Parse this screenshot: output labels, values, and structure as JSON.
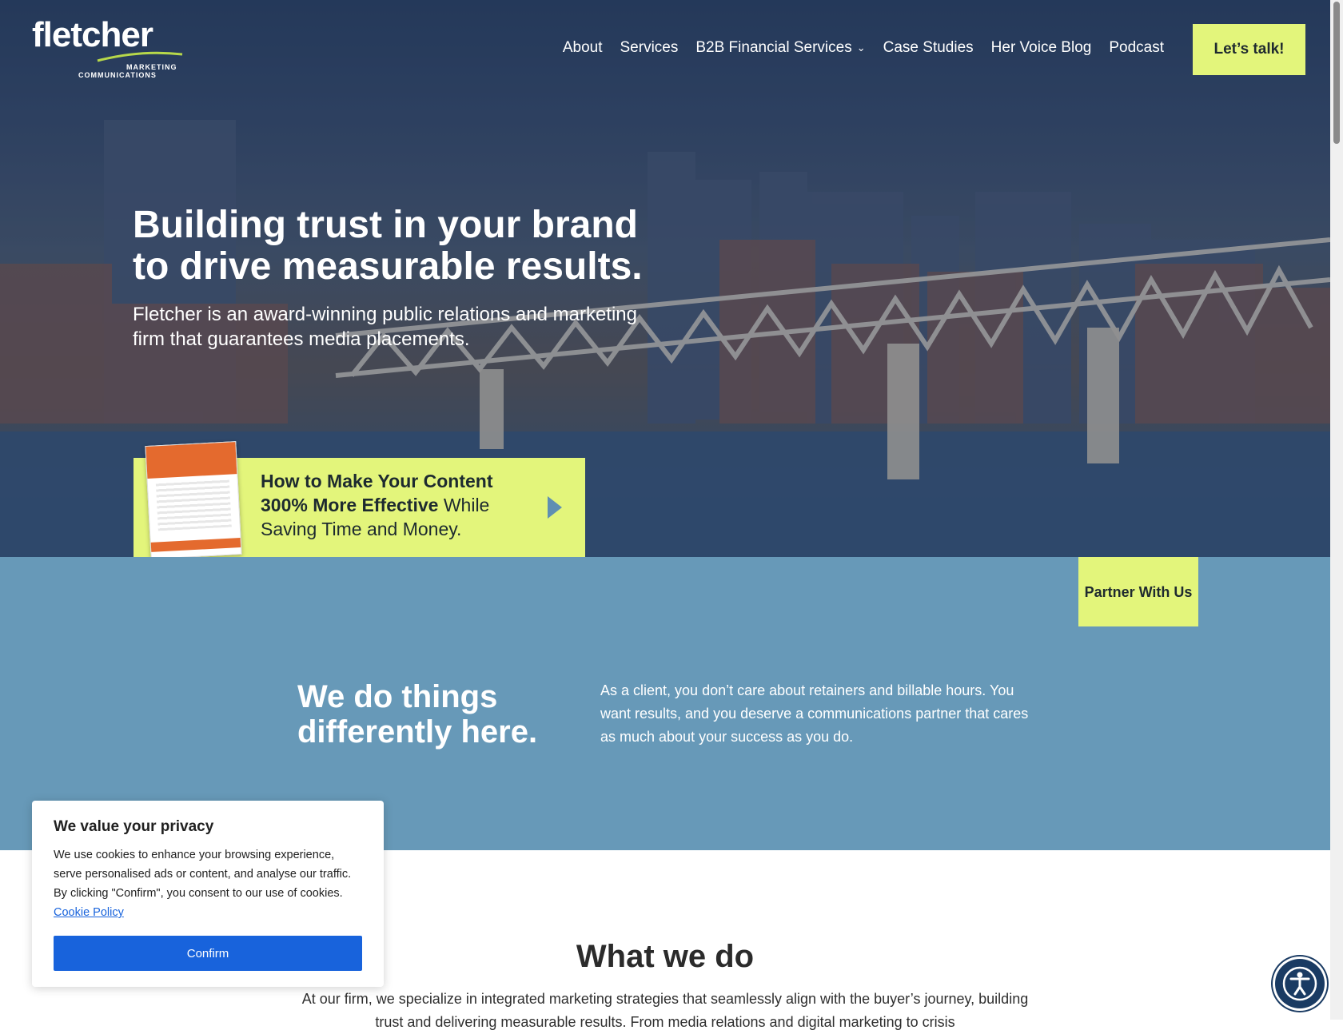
{
  "brand": {
    "logo_word": "fletcher",
    "logo_line1": "MARKETING",
    "logo_line2": "COMMUNICATIONS",
    "accent": "#e3f57b",
    "blue": "#6799b8"
  },
  "nav": {
    "items": [
      {
        "label": "About"
      },
      {
        "label": "Services"
      },
      {
        "label": "B2B Financial Services"
      },
      {
        "label": "Case Studies"
      },
      {
        "label": "Her Voice Blog"
      },
      {
        "label": "Podcast"
      }
    ],
    "cta_label": "Let’s talk!"
  },
  "hero": {
    "title_line1": "Building trust in your brand",
    "title_line2": "to drive measurable results.",
    "subtitle": "Fletcher is an award-winning public relations and marketing firm that guarantees media placements."
  },
  "promo": {
    "bold_text": "How to Make Your Content 300% More Effective",
    "rest_text": " While Saving Time and Money."
  },
  "partner": {
    "label": "Partner With Us"
  },
  "difference": {
    "title": "We do things differently here.",
    "body": "As a client, you don’t care about retainers and billable hours. You want results, and you deserve a communications partner that cares as much about your success as you do."
  },
  "what_we_do": {
    "title": "What we do",
    "body": "At our firm, we specialize in integrated marketing strategies that seamlessly align with the buyer’s journey, building trust and delivering measurable results. From media relations and digital marketing to crisis"
  },
  "cookie": {
    "title": "We value your privacy",
    "body": "We use cookies to enhance your browsing experience, serve personalised ads or content, and analyse our traffic. By clicking \"Confirm\", you consent to our use of cookies.",
    "policy_link": "Cookie Policy",
    "confirm_label": "Confirm"
  },
  "icons": {
    "nav_dropdown": "chevron-down-icon",
    "promo_arrow": "play-arrow-icon",
    "accessibility": "accessibility-icon"
  }
}
